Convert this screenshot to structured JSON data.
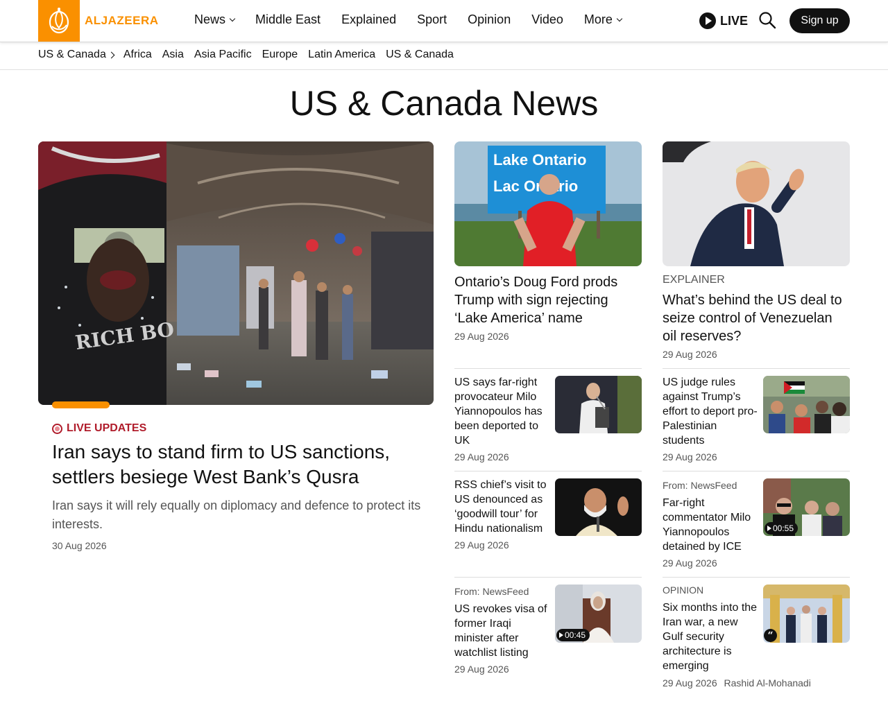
{
  "header": {
    "logo_text": "ALJAZEERA",
    "nav": [
      {
        "label": "News",
        "dropdown": true
      },
      {
        "label": "Middle East",
        "dropdown": false
      },
      {
        "label": "Explained",
        "dropdown": false
      },
      {
        "label": "Sport",
        "dropdown": false
      },
      {
        "label": "Opinion",
        "dropdown": false
      },
      {
        "label": "Video",
        "dropdown": false
      },
      {
        "label": "More",
        "dropdown": true
      }
    ],
    "live_label": "LIVE",
    "signup_label": "Sign up",
    "brand_color": "#fa9000"
  },
  "subnav": {
    "current": "US & Canada",
    "items": [
      "Africa",
      "Asia",
      "Asia Pacific",
      "Europe",
      "Latin America",
      "US & Canada"
    ]
  },
  "page_title": "US & Canada News",
  "feature": {
    "tag": "LIVE UPDATES",
    "title": "Iran says to stand firm to US sanctions, settlers besiege West Bank’s Qusra",
    "summary": "Iran says it will rely equally on diplomacy and defence to protect its interests.",
    "date": "30 Aug 2026"
  },
  "top_cards": [
    {
      "kicker": "",
      "title": "Ontario’s Doug Ford prods Trump with sign rejecting ‘Lake America’ name",
      "date": "29 Aug 2026",
      "sign_line1": "Lake Ontario",
      "sign_line2": "Lac Ontario"
    },
    {
      "kicker": "EXPLAINER",
      "title": "What’s behind the US deal to seize control of Venezuelan oil reserves?",
      "date": "29 Aug 2026"
    }
  ],
  "list_left": [
    {
      "from": "",
      "title": "US says far-right provocateur Milo Yiannopoulos has been deported to UK",
      "date": "29 Aug 2026",
      "duration": ""
    },
    {
      "from": "",
      "title": "RSS chief’s visit to US denounced as ‘goodwill tour’ for Hindu nationalism",
      "date": "29 Aug 2026",
      "duration": ""
    },
    {
      "from": "From: NewsFeed",
      "title": "US revokes visa of former Iraqi minister after watchlist listing",
      "date": "29 Aug 2026",
      "duration": "00:45"
    }
  ],
  "list_right": [
    {
      "from": "",
      "title": "US judge rules against Trump’s effort to deport pro-Palestinian students",
      "date": "29 Aug 2026",
      "duration": ""
    },
    {
      "from": "From: NewsFeed",
      "title": "Far-right commentator Milo Yiannopoulos detained by ICE",
      "date": "29 Aug 2026",
      "duration": "00:55"
    },
    {
      "from": "OPINION",
      "title": "Six months into the Iran war, a new Gulf security architecture is emerging",
      "date": "29 Aug 2026",
      "author": "Rashid Al-Mohanadi",
      "duration": ""
    }
  ]
}
